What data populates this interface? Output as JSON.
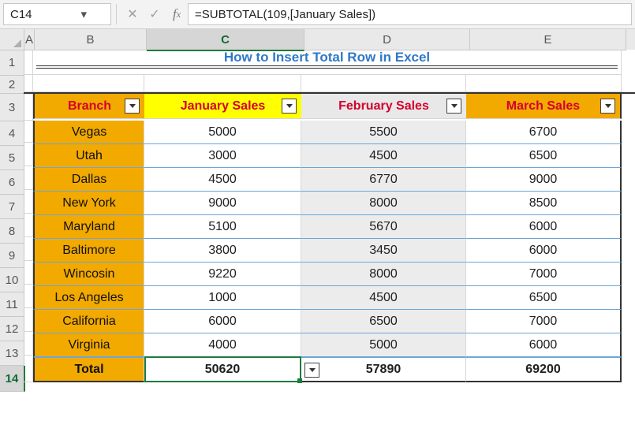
{
  "namebox": "C14",
  "formula": "=SUBTOTAL(109,[January Sales])",
  "columns": [
    "A",
    "B",
    "C",
    "D",
    "E"
  ],
  "rows": [
    "1",
    "2",
    "3",
    "4",
    "5",
    "6",
    "7",
    "8",
    "9",
    "10",
    "11",
    "12",
    "13",
    "14"
  ],
  "title": "How to Insert Total Row in Excel",
  "headers": {
    "branch": "Branch",
    "jan": "January Sales",
    "feb": "February Sales",
    "mar": "March Sales"
  },
  "data": [
    {
      "branch": "Vegas",
      "jan": "5000",
      "feb": "5500",
      "mar": "6700"
    },
    {
      "branch": "Utah",
      "jan": "3000",
      "feb": "4500",
      "mar": "6500"
    },
    {
      "branch": "Dallas",
      "jan": "4500",
      "feb": "6770",
      "mar": "9000"
    },
    {
      "branch": "New York",
      "jan": "9000",
      "feb": "8000",
      "mar": "8500"
    },
    {
      "branch": "Maryland",
      "jan": "5100",
      "feb": "5670",
      "mar": "6000"
    },
    {
      "branch": "Baltimore",
      "jan": "3800",
      "feb": "3450",
      "mar": "6000"
    },
    {
      "branch": "Wincosin",
      "jan": "9220",
      "feb": "8000",
      "mar": "7000"
    },
    {
      "branch": "Los Angeles",
      "jan": "1000",
      "feb": "4500",
      "mar": "6500"
    },
    {
      "branch": "California",
      "jan": "6000",
      "feb": "6500",
      "mar": "7000"
    },
    {
      "branch": "Virginia",
      "jan": "4000",
      "feb": "5000",
      "mar": "6000"
    }
  ],
  "total": {
    "label": "Total",
    "jan": "50620",
    "feb": "57890",
    "mar": "69200"
  },
  "chart_data": {
    "type": "table",
    "title": "How to Insert Total Row in Excel",
    "columns": [
      "Branch",
      "January Sales",
      "February Sales",
      "March Sales"
    ],
    "rows": [
      [
        "Vegas",
        5000,
        5500,
        6700
      ],
      [
        "Utah",
        3000,
        4500,
        6500
      ],
      [
        "Dallas",
        4500,
        6770,
        9000
      ],
      [
        "New York",
        9000,
        8000,
        8500
      ],
      [
        "Maryland",
        5100,
        5670,
        6000
      ],
      [
        "Baltimore",
        3800,
        3450,
        6000
      ],
      [
        "Wincosin",
        9220,
        8000,
        7000
      ],
      [
        "Los Angeles",
        1000,
        4500,
        6500
      ],
      [
        "California",
        6000,
        6500,
        7000
      ],
      [
        "Virginia",
        4000,
        5000,
        6000
      ]
    ],
    "totals": {
      "January Sales": 50620,
      "February Sales": 57890,
      "March Sales": 69200
    }
  }
}
